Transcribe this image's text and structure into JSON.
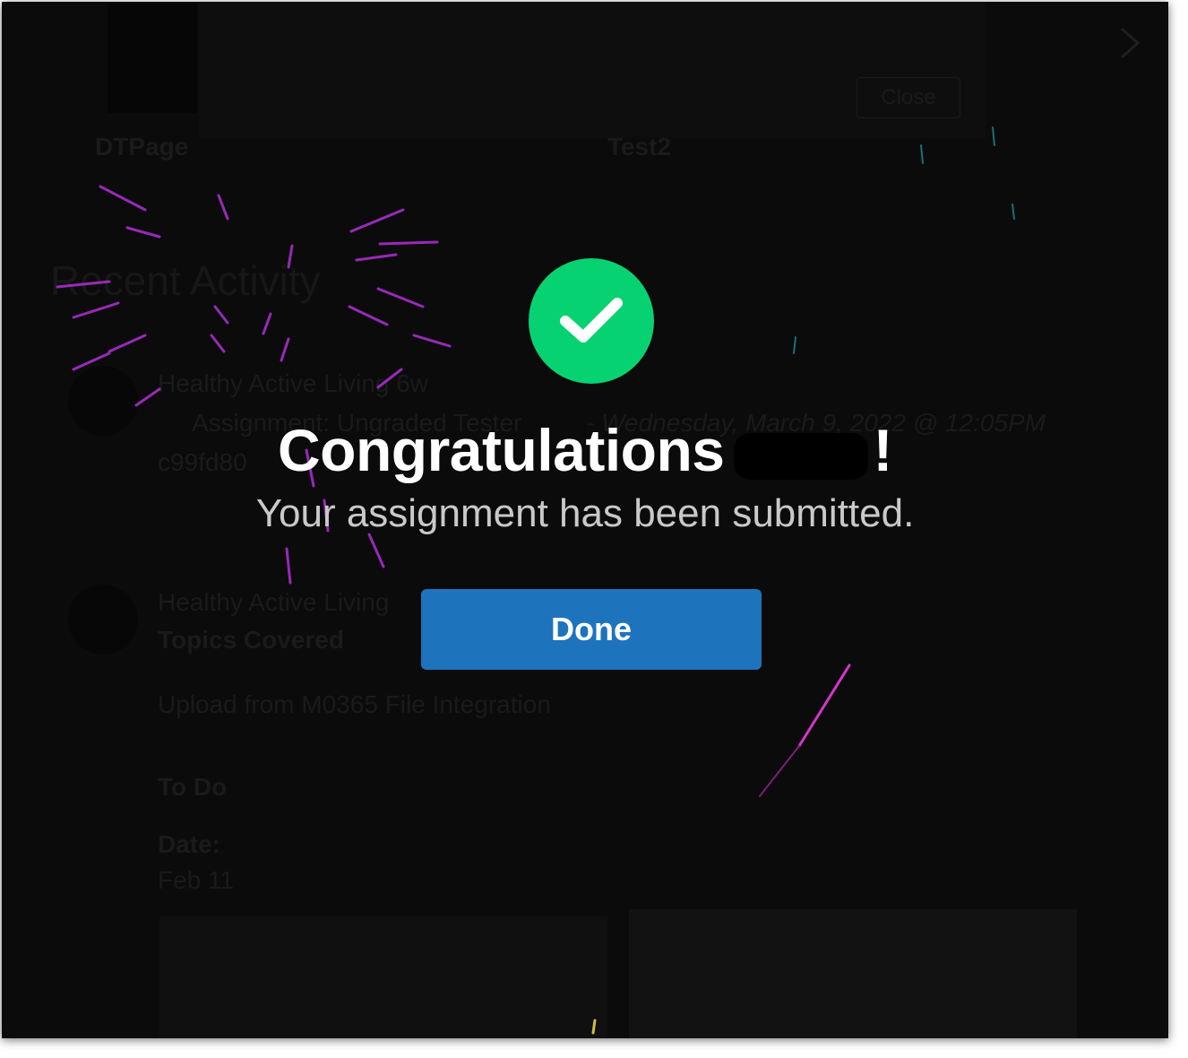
{
  "top_row": {
    "left_label": "DTPage",
    "right_label": "Test2",
    "close_label": "Close"
  },
  "recent": {
    "heading": "Recent Activity",
    "items": [
      {
        "course": "Healthy Active Living 6w",
        "title": "Assignment: Ungraded Tester",
        "date": "- Wednesday, March 9, 2022 @ 12:05PM",
        "code": "c99fd80"
      },
      {
        "course": "Healthy Active Living",
        "title": "Topics Covered",
        "upload": "Upload from M0365 File Integration",
        "todo": "To Do",
        "date_label": "Date:",
        "date_value": "Feb 11"
      }
    ]
  },
  "modal": {
    "title": "Congratulations",
    "exclamation": "!",
    "subtitle": "Your assignment has been submitted.",
    "done_label": "Done",
    "check_icon": "check-icon",
    "check_color": "#07d271",
    "button_color": "#1e73bd"
  }
}
